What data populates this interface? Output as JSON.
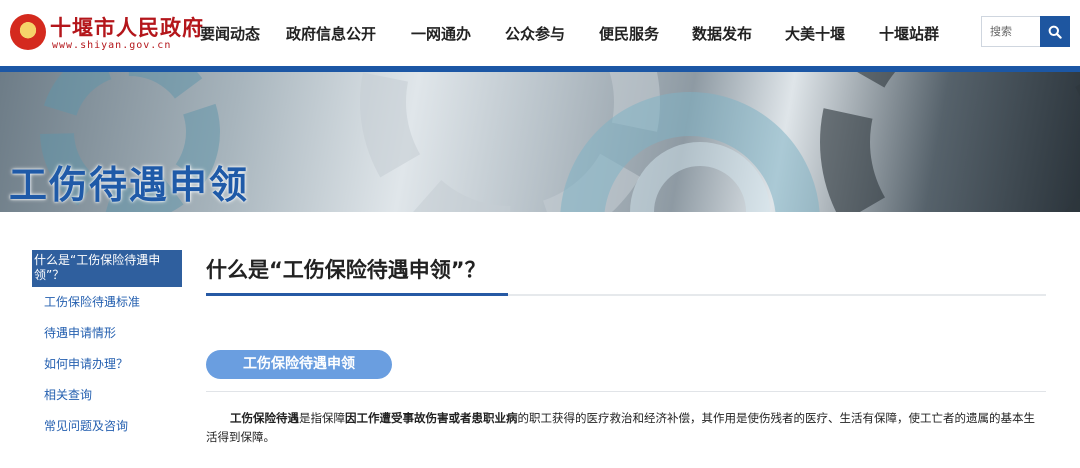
{
  "header": {
    "site_title": "十堰市人民政府",
    "site_url": "www.shiyan.gov.cn",
    "nav": [
      "要闻动态",
      "政府信息公开",
      "一网通办",
      "公众参与",
      "便民服务",
      "数据发布",
      "大美十堰",
      "十堰站群"
    ],
    "search_placeholder": "搜索"
  },
  "banner": {
    "title": "工伤待遇申领"
  },
  "sidebar": {
    "active": "什么是“工伤保险待遇申领”？",
    "items": [
      "工伤保险待遇标准",
      "待遇申请情形",
      "如何申请办理？",
      "相关查询",
      "常见问题及咨询"
    ]
  },
  "main": {
    "title": "什么是“工伤保险待遇申领”？",
    "section_label": "工伤保险待遇申领",
    "paragraph": {
      "b1": "工伤保险待遇",
      "t1": "是指保障",
      "b2": "因工作遭受事故伤害或者患职业病",
      "t2": "的职工获得的医疗救治和经济补偿，其作用是使伤残者的医疗、生活有保障，使工亡者的遗属的基本生活得到保障。"
    }
  },
  "colors": {
    "brand_red": "#b4161b",
    "brand_blue": "#1c57a5",
    "link_blue": "#2560b0",
    "pill_blue": "#6a9ee0"
  }
}
